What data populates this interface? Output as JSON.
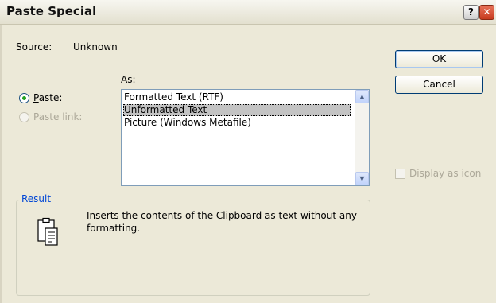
{
  "window": {
    "title": "Paste Special",
    "help_label": "?",
    "close_label": "✕"
  },
  "source": {
    "label": "Source:",
    "value": "Unknown"
  },
  "buttons": {
    "ok": "OK",
    "cancel": "Cancel"
  },
  "as_label": "As:",
  "options": {
    "paste": {
      "label": "Paste:",
      "selected": true,
      "enabled": true
    },
    "paste_link": {
      "label": "Paste link:",
      "selected": false,
      "enabled": false
    }
  },
  "formats": {
    "items": [
      "Formatted Text (RTF)",
      "Unformatted Text",
      "Picture (Windows Metafile)"
    ],
    "selected": "Unformatted Text"
  },
  "display_as_icon": {
    "label": "Display as icon",
    "checked": false,
    "enabled": false
  },
  "result": {
    "title": "Result",
    "text": "Inserts the contents of the Clipboard as text without any formatting."
  },
  "icons": {
    "result": "clipboard-icon",
    "scroll_up": "scroll-up-arrow-icon",
    "scroll_down": "scroll-down-arrow-icon"
  }
}
